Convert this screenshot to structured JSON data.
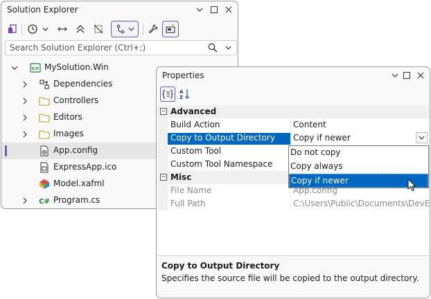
{
  "solution_explorer": {
    "title": "Solution Explorer",
    "search_placeholder": "Search Solution Explorer (Ctrl+;)",
    "tree": [
      {
        "label": "MySolution.Win",
        "icon": "csharp-project-icon",
        "indent": 0,
        "expanded": true
      },
      {
        "label": "Dependencies",
        "icon": "dependencies-icon",
        "indent": 1,
        "expanded": false
      },
      {
        "label": "Controllers",
        "icon": "folder-icon",
        "indent": 1,
        "expanded": false
      },
      {
        "label": "Editors",
        "icon": "folder-icon",
        "indent": 1,
        "expanded": false
      },
      {
        "label": "Images",
        "icon": "folder-icon",
        "indent": 1,
        "expanded": false
      },
      {
        "label": "App.config",
        "icon": "config-file-icon",
        "indent": 1,
        "selected": true
      },
      {
        "label": "ExpressApp.ico",
        "icon": "icon-file-icon",
        "indent": 1
      },
      {
        "label": "Model.xafml",
        "icon": "model-file-icon",
        "indent": 1
      },
      {
        "label": "Program.cs",
        "icon": "csharp-file-icon",
        "indent": 1,
        "expanded": false
      }
    ]
  },
  "properties": {
    "title": "Properties",
    "categories": [
      {
        "name": "Advanced",
        "rows": [
          {
            "name": "Build Action",
            "value": "Content"
          },
          {
            "name": "Copy to Output Directory",
            "value": "Copy if newer",
            "selected": true
          },
          {
            "name": "Custom Tool",
            "value": ""
          },
          {
            "name": "Custom Tool Namespace",
            "value": ""
          }
        ]
      },
      {
        "name": "Misc",
        "rows": [
          {
            "name": "File Name",
            "value": "App.config",
            "disabled": true
          },
          {
            "name": "Full Path",
            "value": "C:\\Users\\Public\\Documents\\DevExpress",
            "disabled": true
          }
        ]
      }
    ],
    "dropdown_options": [
      "Do not copy",
      "Copy always",
      "Copy if newer"
    ],
    "dropdown_selected": "Copy if newer",
    "description": {
      "title": "Copy to Output Directory",
      "text": "Specifies the source file will be copied to the output directory."
    }
  },
  "colors": {
    "accent": "#5a62c8",
    "selection": "#0067c0"
  }
}
